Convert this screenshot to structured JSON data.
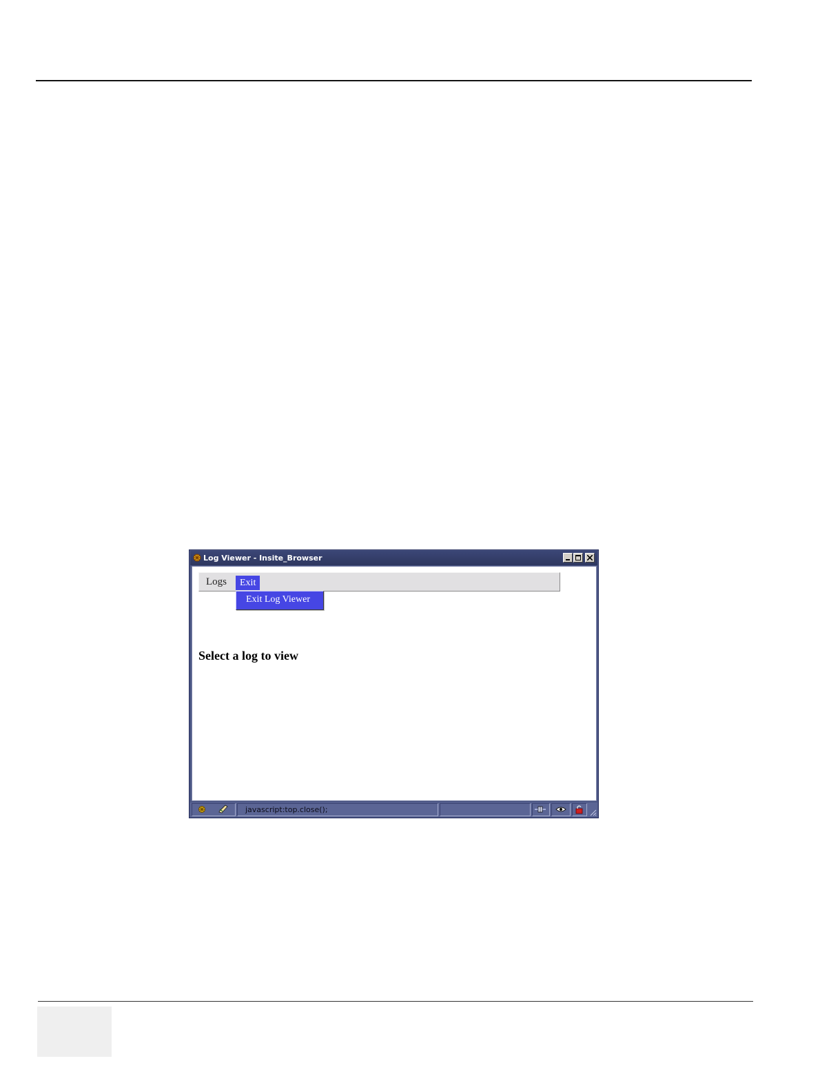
{
  "window": {
    "title": "Log Viewer - Insite_Browser"
  },
  "menubar": {
    "items": [
      {
        "label": "Logs"
      },
      {
        "label": "Exit"
      }
    ]
  },
  "dropdown": {
    "items": [
      {
        "label": "Exit Log Viewer"
      }
    ]
  },
  "main": {
    "heading": "Select a log to view"
  },
  "statusbar": {
    "text": "javascript:top.close();",
    "icons": [
      "globe-icon",
      "edit-icon",
      "connection-icon",
      "privacy-eye-icon",
      "security-lock-icon"
    ]
  },
  "colors": {
    "window_frame": "#4b5684",
    "menu_highlight": "#4646e4",
    "menubar_bg": "#e1e0e2"
  }
}
